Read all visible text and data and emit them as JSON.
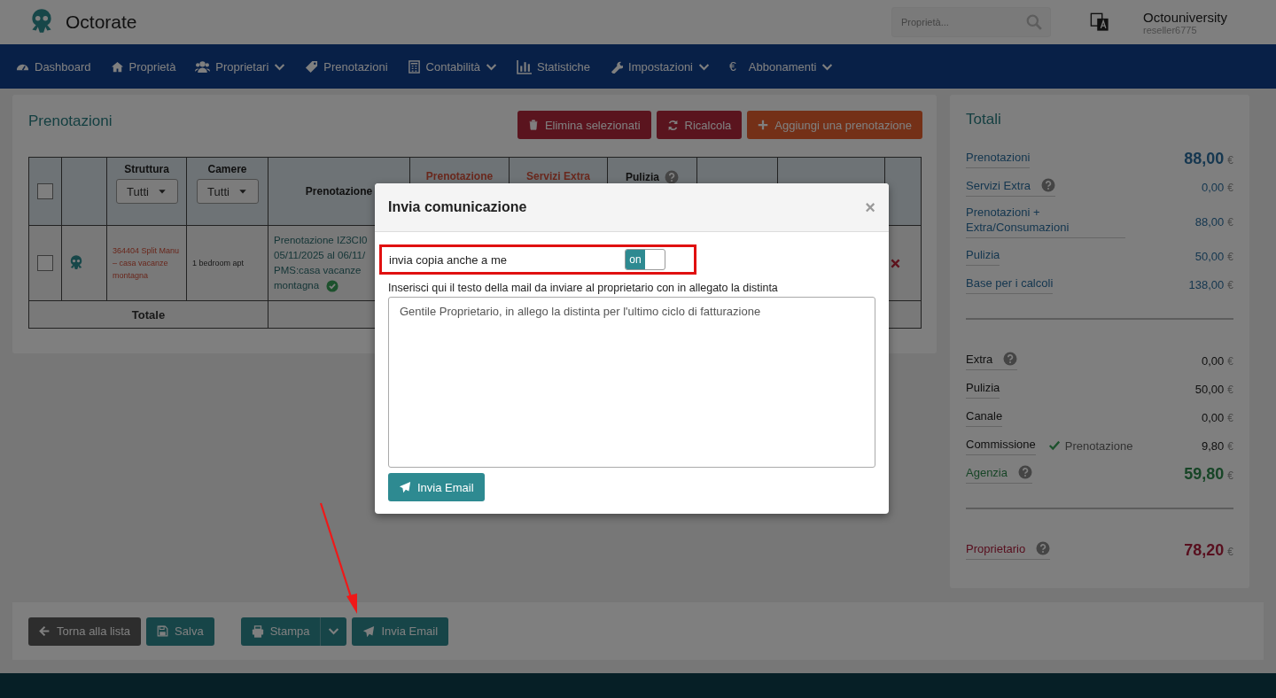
{
  "header": {
    "brand": "Octorate",
    "search": {
      "placeholder": "Proprietà..."
    },
    "user": {
      "name": "Octouniversity",
      "account": "reseller6775"
    }
  },
  "nav": [
    {
      "label": "Dashboard",
      "kind": "gauge",
      "dropdown": false
    },
    {
      "label": "Proprietà",
      "kind": "home",
      "dropdown": false
    },
    {
      "label": "Proprietari",
      "kind": "users",
      "dropdown": true
    },
    {
      "label": "Prenotazioni",
      "kind": "tag",
      "dropdown": false
    },
    {
      "label": "Contabilità",
      "kind": "calculator",
      "dropdown": true
    },
    {
      "label": "Statistiche",
      "kind": "chart",
      "dropdown": false
    },
    {
      "label": "Impostazioni",
      "kind": "wrench",
      "dropdown": true
    },
    {
      "label": "Abbonamenti",
      "glyph": "€",
      "dropdown": true
    }
  ],
  "bookings": {
    "title": "Prenotazioni",
    "actions": [
      {
        "label": "Elimina selezionati",
        "kind": "delete"
      },
      {
        "label": "Ricalcola",
        "kind": "refresh"
      },
      {
        "label": "Aggiungi una prenotazione",
        "kind": "add"
      }
    ],
    "columns": [
      {
        "kind": "checkbox",
        "checked": false
      },
      {
        "kind": "blank"
      },
      {
        "kind": "filter",
        "label": "Struttura",
        "filter": "Tutti"
      },
      {
        "kind": "filter",
        "label": "Camere",
        "filter": "Tutti"
      },
      {
        "kind": "plain",
        "label": "Prenotazione"
      },
      {
        "kind": "accent",
        "label": "Prenotazione"
      },
      {
        "kind": "accent",
        "label": "Servizi Extra"
      },
      {
        "kind": "help",
        "label": "Pulizia"
      },
      {
        "kind": "blank"
      },
      {
        "kind": "blank"
      },
      {
        "kind": "blank"
      }
    ],
    "row": {
      "checked": false,
      "property": "364404 Split Manu – casa vacanze montagna",
      "room": "1 bedroom apt",
      "booking": [
        "Prenotazione IZ3CI0",
        "05/11/2025 al 06/11/",
        "PMS:casa vacanze",
        "montagna"
      ],
      "confirmed": true
    },
    "total_label": "Totale"
  },
  "totals": {
    "title": "Totali",
    "groups": [
      [
        {
          "label": "Prenotazioni",
          "value": "88,00",
          "currency": "€",
          "kind": "blue",
          "big": true,
          "help": false
        },
        {
          "label": "Servizi Extra",
          "value": "0,00",
          "currency": "€",
          "kind": "blue",
          "big": false,
          "help": true
        },
        {
          "label": "Prenotazioni + Extra/Consumazioni",
          "value": "88,00",
          "currency": "€",
          "kind": "blue",
          "big": false,
          "help": false
        },
        {
          "label": "Pulizia",
          "value": "50,00",
          "currency": "€",
          "kind": "blue",
          "big": false,
          "help": false
        },
        {
          "label": "Base per i calcoli",
          "value": "138,00",
          "currency": "€",
          "kind": "blue",
          "big": false,
          "help": false
        }
      ],
      [
        {
          "label": "Extra",
          "value": "0,00",
          "currency": "€",
          "kind": "dark",
          "big": false,
          "help": true
        },
        {
          "label": "Pulizia",
          "value": "50,00",
          "currency": "€",
          "kind": "dark",
          "big": false,
          "help": false
        },
        {
          "label": "Canale",
          "value": "0,00",
          "currency": "€",
          "kind": "dark",
          "big": false,
          "help": false
        },
        {
          "label": "Commissione",
          "note": "Prenotazione",
          "value": "9,80",
          "currency": "€",
          "kind": "dark",
          "big": false,
          "help": false
        },
        {
          "label": "Agenzia",
          "value": "59,80",
          "currency": "€",
          "kind": "green",
          "big": true,
          "help": true
        }
      ],
      [
        {
          "label": "Proprietario",
          "value": "78,20",
          "currency": "€",
          "kind": "red",
          "big": true,
          "help": true
        }
      ]
    ]
  },
  "footer_buttons": [
    {
      "label": "Torna alla lista",
      "kind": "back"
    },
    {
      "label": "Salva",
      "kind": "save"
    },
    {
      "label": "Stampa",
      "kind": "print"
    },
    {
      "label": "Invia Email",
      "kind": "send"
    }
  ],
  "modal": {
    "title": "Invia comunicazione",
    "close": "×",
    "copy_label": "invia copia anche a me",
    "toggle": {
      "label": "on",
      "on": true
    },
    "message_label": "Inserisci qui il testo della mail da inviare al proprietario con in allegato la distinta",
    "message": "Gentile Proprietario, in allego la distinta per l'ultimo ciclo di fatturazione",
    "send": "Invia Email"
  }
}
